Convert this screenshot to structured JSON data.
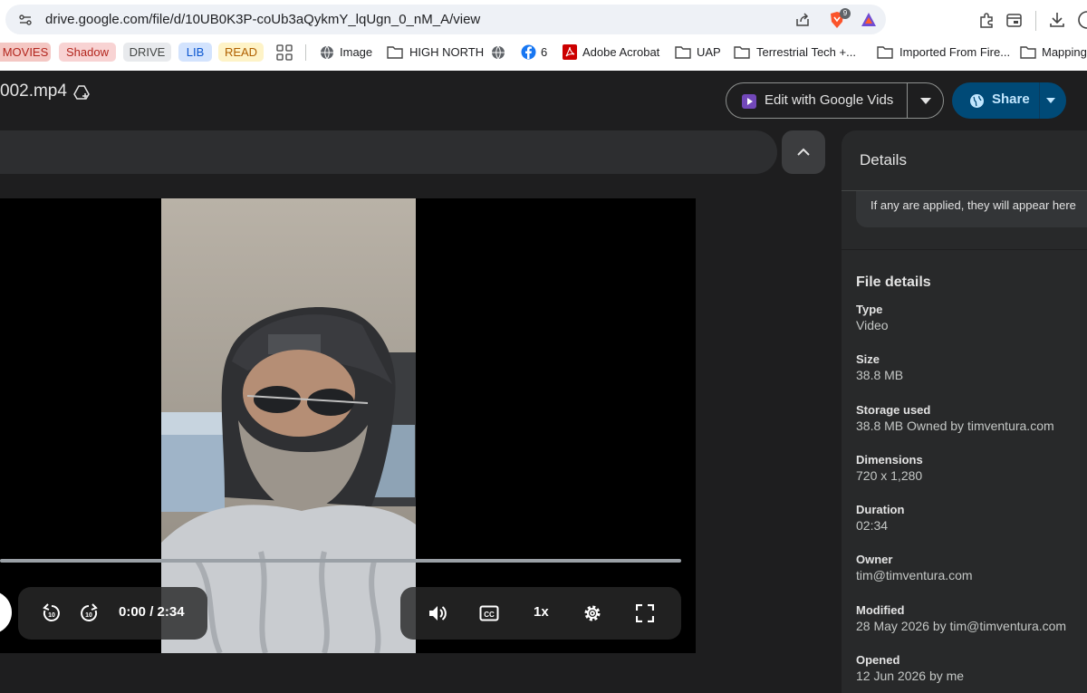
{
  "browser": {
    "url": "drive.google.com/file/d/10UB0K3P-coUb3aQykmY_lqUgn_0_nM_A/view",
    "brave_badge": "9",
    "bookmarks": {
      "movies": "MOVIES",
      "shadow": "Shadow",
      "drive": "DRIVE",
      "lib": "LIB",
      "read": "READ",
      "image": "Image",
      "high_north": "HIGH NORTH",
      "facebook": "6",
      "acrobat": "Adobe Acrobat",
      "uap": "UAP",
      "terrestrial": "Terrestrial Tech +...",
      "imported": "Imported From Fire...",
      "mapping": "Mapping"
    },
    "colors": {
      "movies": "#f4c7c3",
      "shadow": "#f8d3d3",
      "drive": "#e8eaed",
      "lib": "#d3e3fd",
      "read": "#fef3c7"
    }
  },
  "drive": {
    "file_title": "002.mp4",
    "edit_button": "Edit with Google Vids",
    "share_button": "Share"
  },
  "player": {
    "time": "0:00 / 2:34",
    "speed": "1x",
    "progress_fraction": 0
  },
  "details": {
    "heading": "Details",
    "note": "If any are applied, they will appear here",
    "file_details_heading": "File details",
    "fields": [
      {
        "label": "Type",
        "value": "Video"
      },
      {
        "label": "Size",
        "value": "38.8 MB"
      },
      {
        "label": "Storage used",
        "value": "38.8 MB Owned by timventura.com"
      },
      {
        "label": "Dimensions",
        "value": "720 x 1,280"
      },
      {
        "label": "Duration",
        "value": "02:34"
      },
      {
        "label": "Owner",
        "value": "tim@timventura.com"
      },
      {
        "label": "Modified",
        "value": "28 May 2026 by tim@timventura.com"
      },
      {
        "label": "Opened",
        "value": "12 Jun 2026 by me"
      }
    ]
  }
}
